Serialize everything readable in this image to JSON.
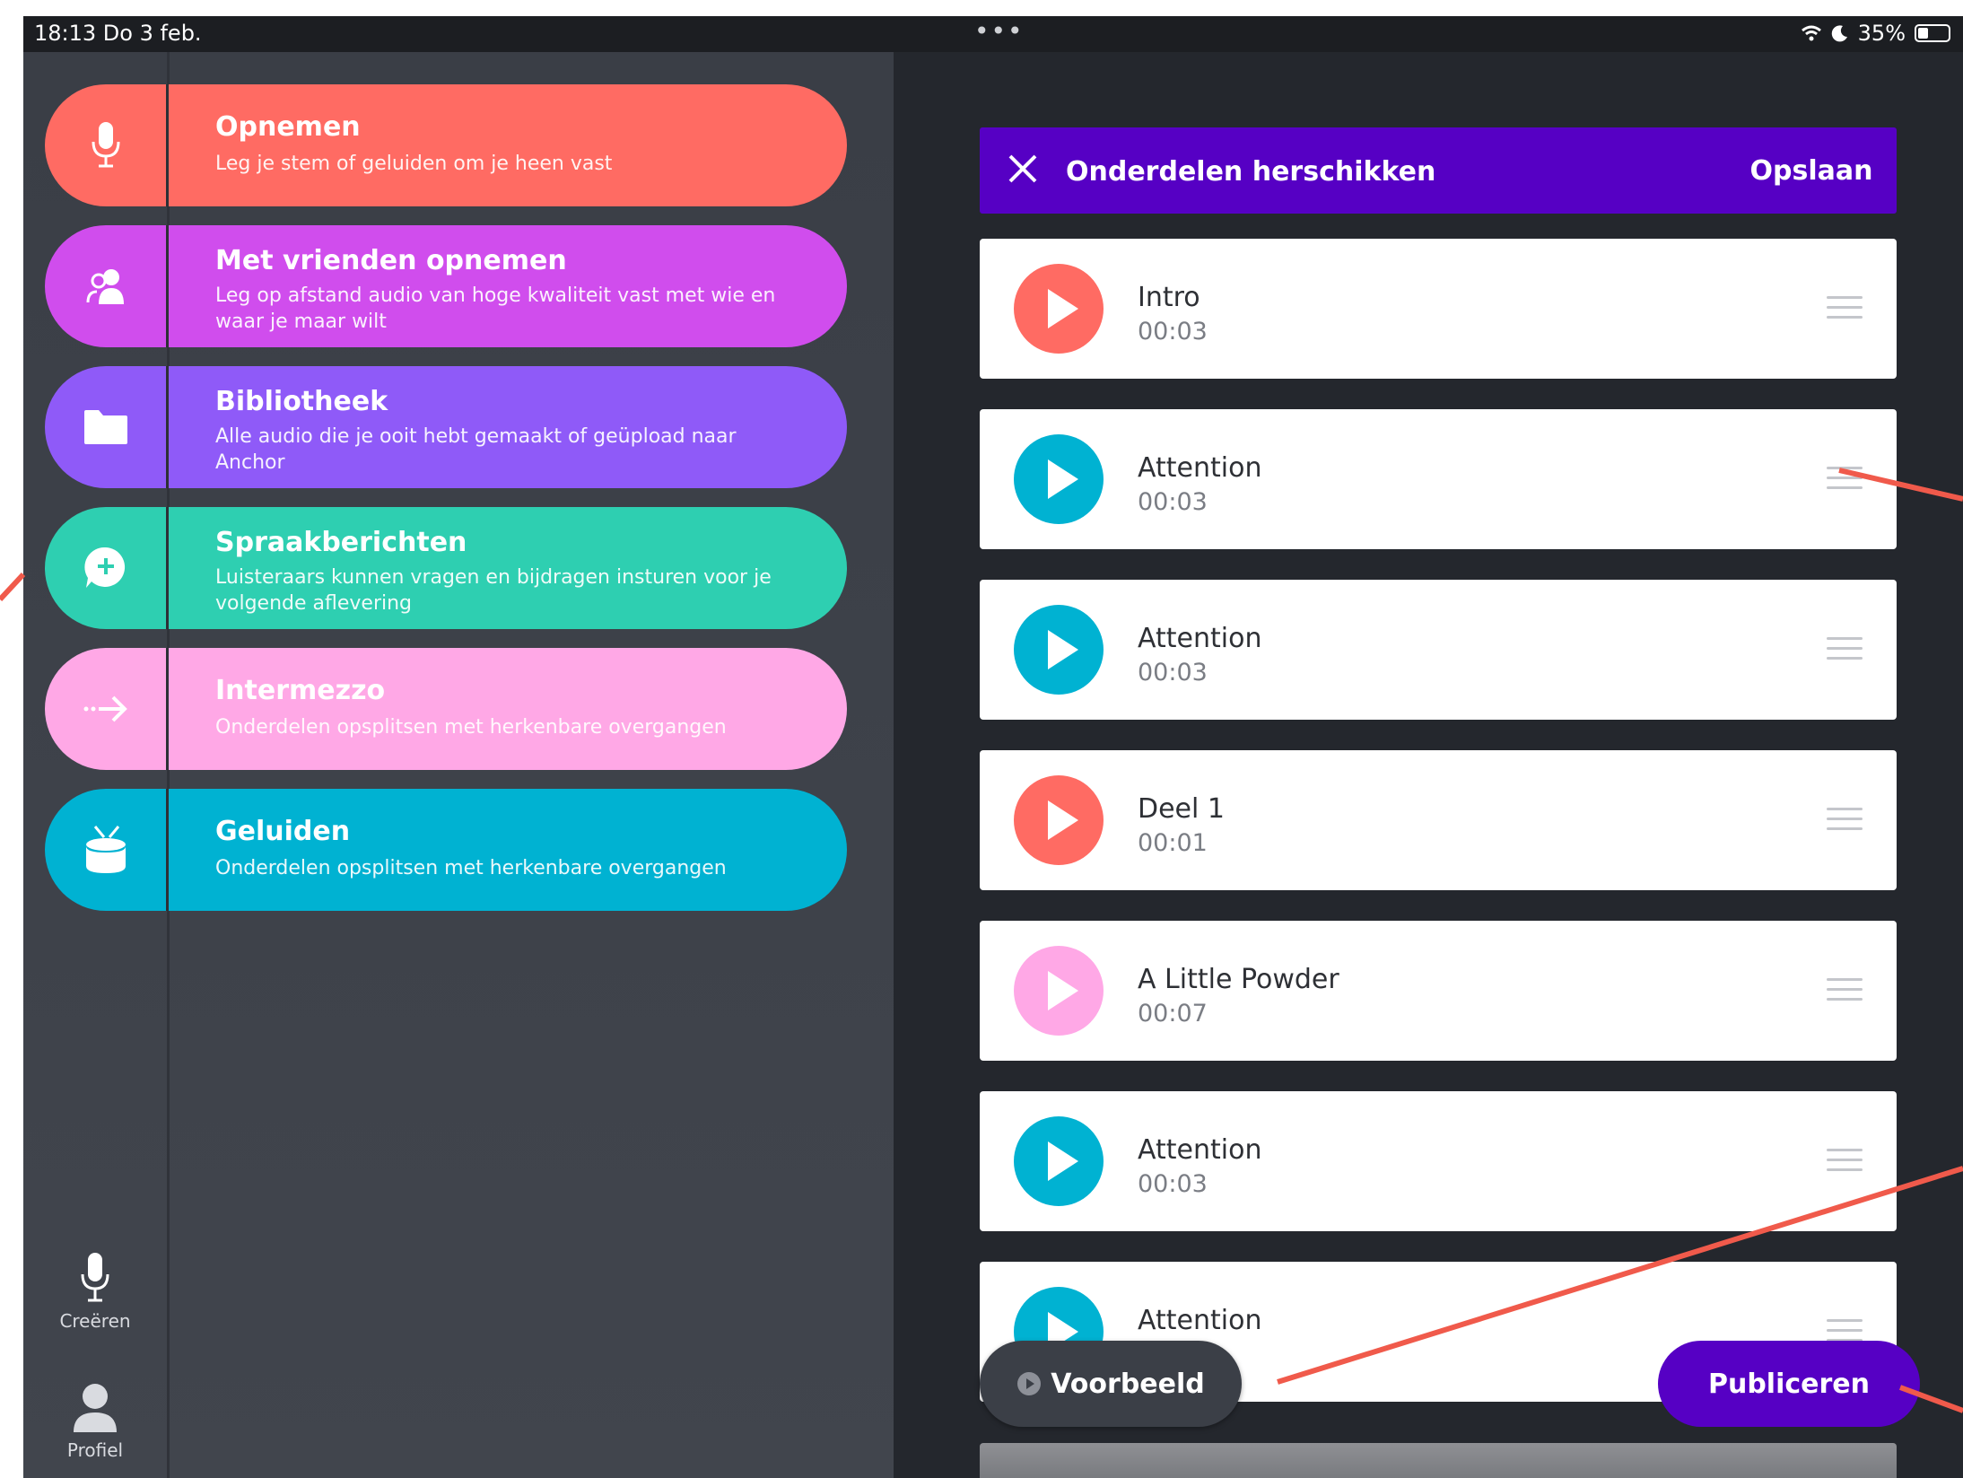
{
  "status_bar": {
    "time_date": "18:13   Do 3 feb.",
    "center_dots": "•••",
    "battery": "35%",
    "battery_level": 0.35
  },
  "menu": [
    {
      "title": "Opnemen",
      "desc": "Leg je stem of geluiden om je heen vast",
      "color": "#ff6b63",
      "icon": "microphone-icon"
    },
    {
      "title": "Met vrienden opnemen",
      "desc": "Leg op afstand audio van hoge kwaliteit vast met wie en waar je maar wilt",
      "color": "#d04ded",
      "icon": "people-icon"
    },
    {
      "title": "Bibliotheek",
      "desc": "Alle audio die je ooit hebt gemaakt of geüpload naar Anchor",
      "color": "#8f5af8",
      "icon": "folder-icon"
    },
    {
      "title": "Spraakberichten",
      "desc": "Luisteraars kunnen vragen en bijdragen insturen voor je volgende aflevering",
      "color": "#2ecfb1",
      "icon": "message-plus-icon"
    },
    {
      "title": "Intermezzo",
      "desc": "Onderdelen opsplitsen met herkenbare overgangen",
      "color": "#ffa8e6",
      "icon": "transition-arrow-icon"
    },
    {
      "title": "Geluiden",
      "desc": "Onderdelen opsplitsen met herkenbare overgangen",
      "color": "#00b2d2",
      "icon": "drum-icon"
    }
  ],
  "rail": {
    "create_label": "Creëren",
    "profile_label": "Profiel"
  },
  "header": {
    "title": "Onderdelen herschikken",
    "save_label": "Opslaan",
    "color": "#5600c4"
  },
  "segments": [
    {
      "name": "Intro",
      "duration": "00:03",
      "color": "#ff6b63"
    },
    {
      "name": "Attention",
      "duration": "00:03",
      "color": "#00b2d2"
    },
    {
      "name": "Attention",
      "duration": "00:03",
      "color": "#00b2d2"
    },
    {
      "name": "Deel 1",
      "duration": "00:01",
      "color": "#ff6b63"
    },
    {
      "name": "A Little Powder",
      "duration": "00:07",
      "color": "#ffa8e6"
    },
    {
      "name": "Attention",
      "duration": "00:03",
      "color": "#00b2d2"
    },
    {
      "name": "Attention",
      "duration": "",
      "color": "#00b2d2"
    }
  ],
  "footer": {
    "preview_label": "Voorbeeld",
    "publish_label": "Publiceren"
  },
  "annotation_color": "#f05a4b"
}
